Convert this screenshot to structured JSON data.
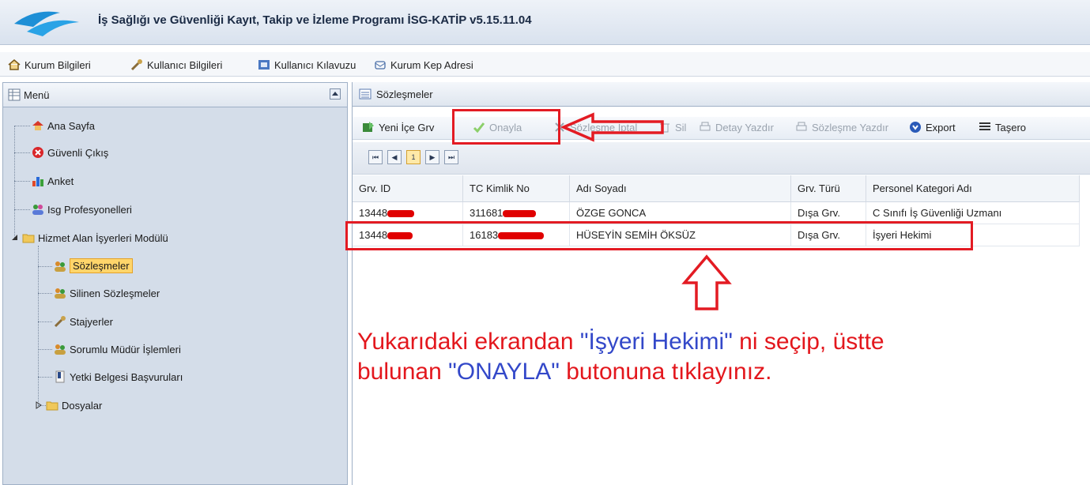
{
  "app": {
    "title": "İş Sağlığı ve Güvenliği Kayıt, Takip ve İzleme Programı İSG-KATİP v5.15.11.04"
  },
  "toolbar": {
    "items": [
      {
        "label": "Kurum Bilgileri",
        "icon": "house-icon"
      },
      {
        "label": "Kullanıcı Bilgileri",
        "icon": "user-wrench-icon"
      },
      {
        "label": "Kullanıcı Kılavuzu",
        "icon": "manual-icon"
      },
      {
        "label": "Kurum Kep Adresi",
        "icon": "mail-icon"
      }
    ]
  },
  "menu": {
    "title": "Menü",
    "items": [
      {
        "label": "Ana Sayfa"
      },
      {
        "label": "Güvenli Çıkış"
      },
      {
        "label": "Anket"
      },
      {
        "label": "Isg Profesyonelleri"
      },
      {
        "label": "Hizmet Alan İşyerleri Modülü"
      },
      {
        "label": "Sözleşmeler"
      },
      {
        "label": "Silinen Sözleşmeler"
      },
      {
        "label": "Stajyerler"
      },
      {
        "label": "Sorumlu Müdür İşlemleri"
      },
      {
        "label": "Yetki Belgesi Başvuruları"
      },
      {
        "label": "Dosyalar"
      }
    ]
  },
  "contracts": {
    "title": "Sözleşmeler",
    "toolbar": {
      "new": "Yeni İçe Grv",
      "approve": "Onayla",
      "cancel": "Sözleşme İptal",
      "delete": "Sil",
      "print_detail": "Detay Yazdır",
      "print_contract": "Sözleşme Yazdır",
      "export": "Export",
      "subcontractor": "Taşero"
    },
    "pager": {
      "current_page": "1"
    },
    "columns": [
      "Grv. ID",
      "TC Kimlik No",
      "Adı Soyadı",
      "Grv. Türü",
      "Personel Kategori Adı"
    ],
    "rows": [
      {
        "id": "13448",
        "tc": "311681",
        "name": "ÖZGE GONCA",
        "type": "Dışa Grv.",
        "category": "C Sınıfı İş Güvenliği Uzmanı"
      },
      {
        "id": "13448",
        "tc": "16183",
        "name": "HÜSEYİN SEMİH ÖKSÜZ",
        "type": "Dışa Grv.",
        "category": "İşyeri Hekimi"
      }
    ]
  },
  "instruction": {
    "line1_a": "Yukarıdaki ekrandan ",
    "line1_b": "\"İşyeri Hekimi\"",
    "line1_c": " ni seçip, üstte",
    "line2_a": "bulunan ",
    "line2_b": "\"ONAYLA\"",
    "line2_c": " butonuna tıklayınız."
  },
  "colors": {
    "annotation_red": "#e31b23",
    "annotation_blue": "#3348c9"
  }
}
